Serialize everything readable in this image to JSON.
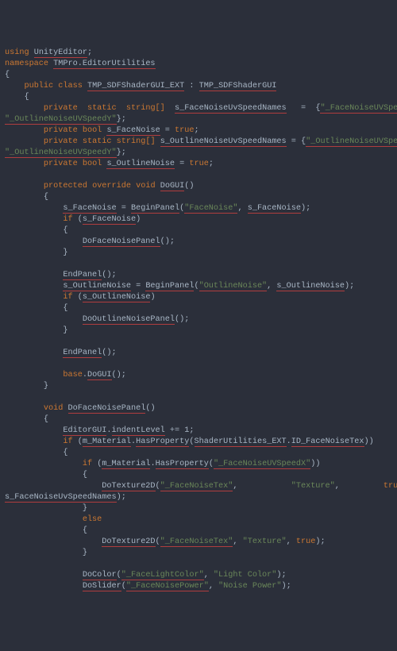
{
  "code": {
    "using_kw": "using",
    "using_ns": "UnityEditor",
    "namespace_kw": "namespace",
    "namespace_name": "TMPro.EditorUtilities",
    "public": "public",
    "class": "class",
    "class_name": "TMP_SDFShaderGUI_EXT",
    "colon": " : ",
    "base_class": "TMP_SDFShaderGUI",
    "private": "private",
    "static": "static",
    "string_arr": "string[]",
    "bool": "bool",
    "true": "true",
    "protected": "protected",
    "override": "override",
    "void": "void",
    "if": "if",
    "else": "else",
    "base": "base",
    "s_FaceNoiseUvSpeedNames": "s_FaceNoiseUvSpeedNames",
    "fn_arr_open": "{",
    "fn_x": "\"_FaceNoiseUVSpeedX\"",
    "fn_y": "\"_OutlineNoiseUVSpeedY\"",
    "fn_arr_close": "};",
    "s_FaceNoise": "s_FaceNoise",
    "s_OutlineNoiseUvSpeedNames": "s_OutlineNoiseUvSpeedNames",
    "on_x": "\"_OutlineNoiseUVSpeedX\"",
    "on_y": "\"_OutlineNoiseUVSpeedY\"",
    "s_OutlineNoise": "s_OutlineNoise",
    "DoGUI": "DoGUI",
    "BeginPanel": "BeginPanel",
    "FaceNoise_str": "\"FaceNoise\"",
    "DoFaceNoisePanel": "DoFaceNoisePanel",
    "EndPanel": "EndPanel",
    "OutlineNoise_str": "\"OutlineNoise\"",
    "DoOutlineNoisePanel": "DoOutlineNoisePanel",
    "EditorGUI": "EditorGUI",
    "indentLevel": "indentLevel",
    "plus_eq_1": " += 1;",
    "m_Material": "m_Material",
    "HasProperty": "HasProperty",
    "ShaderUtilities_EXT": "ShaderUtilities_EXT",
    "ID_FaceNoiseTex": "ID_FaceNoiseTex",
    "FaceNoiseUVSpeedX_str": "\"_FaceNoiseUVSpeedX\"",
    "DoTexture2D": "DoTexture2D",
    "FaceNoiseTex_str": "\"_FaceNoiseTex\"",
    "Texture_str": "\"Texture\"",
    "DoColor": "DoColor",
    "FaceLightColor_str": "\"_FaceLightColor\"",
    "LightColor_str": "\"Light Color\"",
    "DoSlider": "DoSlider",
    "FaceNoisePower_str": "\"_FaceNoisePower\"",
    "NoisePower_str": "\"Noise Power\"",
    "eq": " = ",
    "semi": ";",
    "comma": ", ",
    "comma_sp": ",",
    "lp": "(",
    "rp": ")",
    "lb": "{",
    "rb": "}",
    "dot": "."
  }
}
